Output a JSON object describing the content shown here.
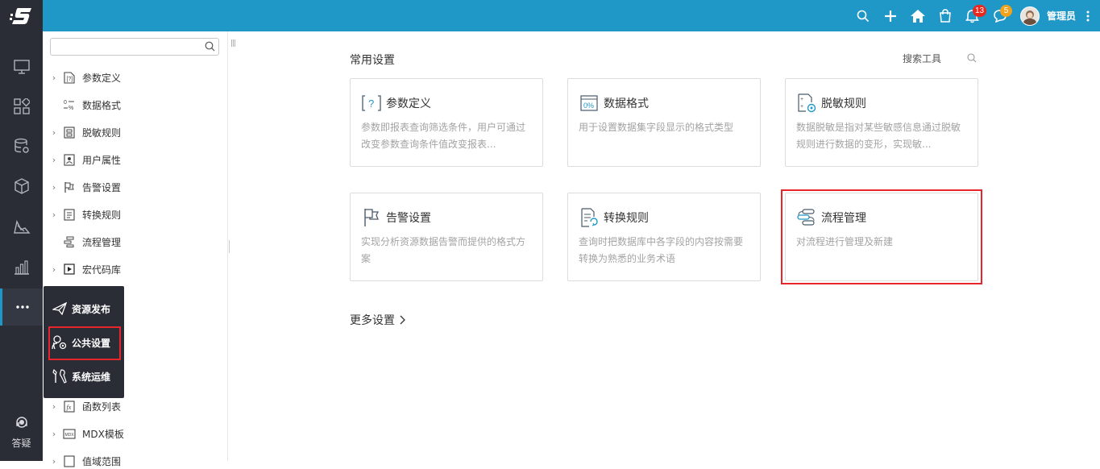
{
  "header": {
    "user_name": "管理员",
    "notifications_count": "13",
    "messages_count": "5",
    "icons": [
      "search-icon",
      "plus-icon",
      "home-icon",
      "bag-icon",
      "bell-icon",
      "chat-icon",
      "more-vertical-icon"
    ]
  },
  "rail": {
    "items": [
      "monitor-icon",
      "apps-icon",
      "database-settings-icon",
      "cube-icon",
      "analysis-icon",
      "bar-chart-icon",
      "more-icon"
    ],
    "help_label": "答疑"
  },
  "tree": {
    "search_placeholder": "",
    "items": [
      {
        "label": "参数定义",
        "icon": "param-icon",
        "has_arrow": true
      },
      {
        "label": "数据格式",
        "icon": "format-icon",
        "has_arrow": false
      },
      {
        "label": "脱敏规则",
        "icon": "mask-icon",
        "has_arrow": true
      },
      {
        "label": "用户属性",
        "icon": "user-attr-icon",
        "has_arrow": true
      },
      {
        "label": "告警设置",
        "icon": "flag-icon",
        "has_arrow": true
      },
      {
        "label": "转换规则",
        "icon": "convert-icon",
        "has_arrow": true
      },
      {
        "label": "流程管理",
        "icon": "flow-icon",
        "has_arrow": false
      },
      {
        "label": "宏代码库",
        "icon": "macro-icon",
        "has_arrow": true
      },
      {
        "label": "函数列表",
        "icon": "function-icon",
        "has_arrow": true
      },
      {
        "label": "MDX模板",
        "icon": "mdx-icon",
        "has_arrow": true
      },
      {
        "label": "值域范围",
        "icon": "range-icon",
        "has_arrow": true
      }
    ]
  },
  "popup": {
    "items": [
      {
        "label": "资源发布",
        "icon": "send-icon"
      },
      {
        "label": "公共设置",
        "icon": "public-settings-icon"
      },
      {
        "label": "系统运维",
        "icon": "tools-icon"
      }
    ]
  },
  "main": {
    "section_title": "常用设置",
    "search_tool_label": "搜索工具",
    "more_settings_label": "更多设置",
    "cards": [
      {
        "title": "参数定义",
        "desc": "参数即报表查询筛选条件，用户可通过改变参数查询条件值改变报表..."
      },
      {
        "title": "数据格式",
        "desc": "用于设置数据集字段显示的格式类型"
      },
      {
        "title": "脱敏规则",
        "desc": "数据脱敏是指对某些敏感信息通过脱敏规则进行数据的变形，实现敏..."
      },
      {
        "title": "告警设置",
        "desc": "实现分析资源数据告警而提供的格式方案"
      },
      {
        "title": "转换规则",
        "desc": "查询时把数据库中各字段的内容按需要转换为熟悉的业务术语"
      },
      {
        "title": "流程管理",
        "desc": "对流程进行管理及新建"
      }
    ]
  },
  "colors": {
    "header_bg": "#1f98c8",
    "rail_bg": "#2a2d36",
    "highlight": "#e6262d",
    "badge_red": "#e8281f",
    "badge_orange": "#f0a21c"
  }
}
